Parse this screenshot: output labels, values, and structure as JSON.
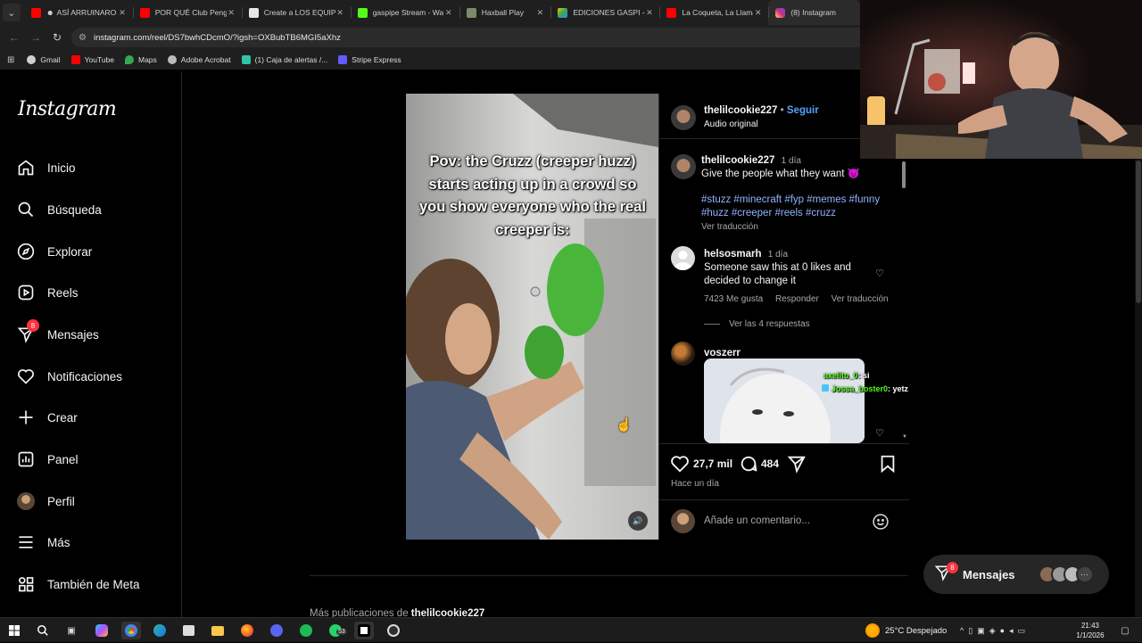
{
  "browser": {
    "tabs": [
      {
        "label": "ASÍ ARRUINARON",
        "icon_color": "#ff0000",
        "icon": "youtube-icon"
      },
      {
        "label": "POR QUÉ Club Pengu",
        "icon_color": "#ff0000",
        "icon": "youtube-icon"
      },
      {
        "label": "Create a LOS EQUIPC",
        "icon_color": "#e8e8e8",
        "icon": "page-icon"
      },
      {
        "label": "gaspipe Stream - Wa",
        "icon_color": "#53fc18",
        "icon": "kick-icon"
      },
      {
        "label": "Haxball Play",
        "icon_color": "#7a8a6a",
        "icon": "haxball-icon"
      },
      {
        "label": "EDICIONES GASPI - G",
        "icon_color": "#34a853",
        "icon": "drive-icon"
      },
      {
        "label": "La Coqueta, La Llama",
        "icon_color": "#ff0000",
        "icon": "youtube-icon"
      },
      {
        "label": "(8) Instagram",
        "icon_color": "#d62976",
        "icon": "instagram-icon"
      }
    ],
    "url": "instagram.com/reel/DS7bwhCDcmO/?igsh=OXBubTB6MGI5aXhz",
    "bookmarks": [
      {
        "label": "Gmail",
        "icon": "gmail-icon",
        "color": "#ea4335"
      },
      {
        "label": "YouTube",
        "icon": "youtube-icon",
        "color": "#ff0000"
      },
      {
        "label": "Maps",
        "icon": "maps-icon",
        "color": "#34a853"
      },
      {
        "label": "Adobe Acrobat",
        "icon": "acrobat-icon",
        "color": "#bbbbbb"
      },
      {
        "label": "(1) Caja de alertas /...",
        "icon": "alerts-icon",
        "color": "#2ec4a5"
      },
      {
        "label": "Stripe Express",
        "icon": "stripe-icon",
        "color": "#635bff"
      }
    ]
  },
  "sidebar": {
    "logo": "Instagram",
    "items": [
      {
        "label": "Inicio",
        "icon": "home-icon"
      },
      {
        "label": "Búsqueda",
        "icon": "search-icon"
      },
      {
        "label": "Explorar",
        "icon": "compass-icon"
      },
      {
        "label": "Reels",
        "icon": "reels-icon"
      },
      {
        "label": "Mensajes",
        "icon": "messenger-icon",
        "badge": "8"
      },
      {
        "label": "Notificaciones",
        "icon": "heart-icon"
      },
      {
        "label": "Crear",
        "icon": "plus-icon"
      },
      {
        "label": "Panel",
        "icon": "dashboard-icon"
      },
      {
        "label": "Perfil",
        "icon": "avatar-icon"
      },
      {
        "label": "Más",
        "icon": "menu-icon"
      },
      {
        "label": "También de Meta",
        "icon": "meta-grid-icon"
      }
    ]
  },
  "video": {
    "caption_text": "Pov: the Cruzz (creeper huzz) starts acting up in a crowd so you show everyone who the real creeper is:"
  },
  "post": {
    "author": "thelilcookie227",
    "follow_label": "Seguir",
    "audio": "Audio original",
    "caption": {
      "user": "thelilcookie227",
      "time": "1 día",
      "text": "Give the people what they want 😈",
      "hashtags": "#stuzz #minecraft #fyp #memes #funny #huzz #creeper #reels #cruzz",
      "translate": "Ver traducción"
    },
    "comments": [
      {
        "user": "helsosmarh",
        "time": "1 día",
        "text": "Someone saw this at 0 likes and decided to change it",
        "likes": "7423 Me gusta",
        "reply": "Responder",
        "translate": "Ver traducción",
        "replies": "Ver las 4 respuestas"
      },
      {
        "user": "voszerr"
      }
    ],
    "likes_count": "27,7 mil",
    "comments_count": "484",
    "posted": "Hace un día",
    "add_comment_placeholder": "Añade un comentario..."
  },
  "overlay_chat": [
    {
      "user": "axelito_0",
      "text": ": si"
    },
    {
      "user": "Jossa_boster0",
      "text": ": yetz"
    }
  ],
  "more_posts": {
    "prefix": "Más publicaciones de",
    "user": "thelilcookie227"
  },
  "messages_pill": {
    "label": "Mensajes",
    "badge": "8"
  },
  "taskbar": {
    "whatsapp_badge": "53",
    "weather": "25°C  Despejado",
    "time": "21:43",
    "date": "1/1/2026"
  }
}
